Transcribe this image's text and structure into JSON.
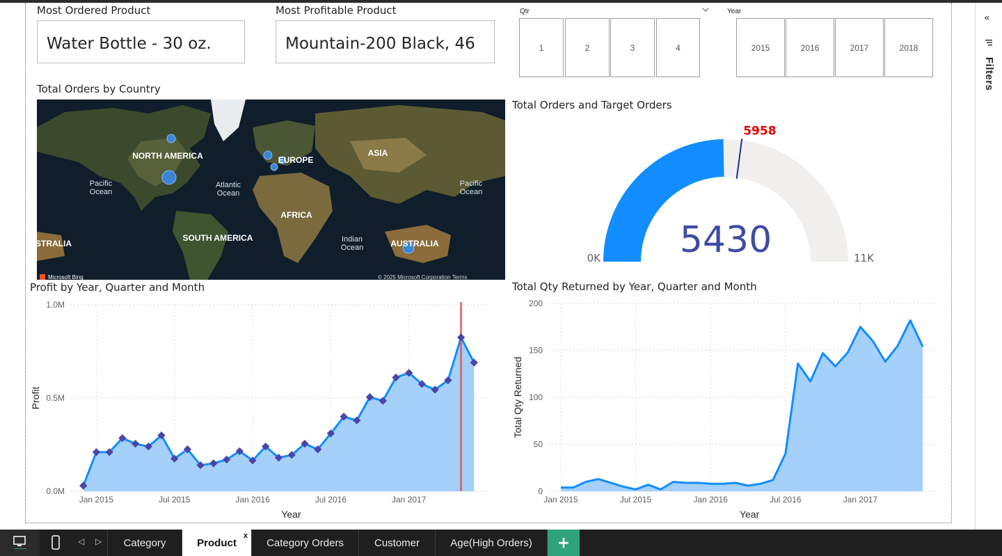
{
  "sidebar": {
    "collapse_glyph": "«",
    "filters_label": "Filters",
    "filter_icon": "filter-icon"
  },
  "cards": {
    "most_ordered": {
      "title": "Most Ordered Product",
      "value": "Water Bottle - 30 oz."
    },
    "most_profitable": {
      "title": "Most Profitable Product",
      "value": "Mountain-200 Black, 46"
    }
  },
  "slicers": {
    "qtr": {
      "title": "Qtr",
      "options": [
        "1",
        "2",
        "3",
        "4"
      ]
    },
    "year": {
      "title": "Year",
      "options": [
        "2015",
        "2016",
        "2017",
        "2018"
      ]
    }
  },
  "map": {
    "title": "Total Orders by Country",
    "labels": [
      "NORTH AMERICA",
      "EUROPE",
      "ASIA",
      "Pacific\nOcean",
      "Atlantic\nOcean",
      "Pacific\nOcean",
      "AFRICA",
      "SOUTH AMERICA",
      "Indian\nOcean",
      "AUSTRALIA",
      "STRALIA"
    ],
    "attribution_left": "Microsoft Bing",
    "attribution_right": "© 2025 Microsoft Corporation   Terms"
  },
  "gauge": {
    "title": "Total Orders and Target Orders",
    "value": 5430,
    "value_label": "5430",
    "target": 5958,
    "target_label": "5958",
    "min": 0,
    "max": 11000,
    "min_label": "0K",
    "max_label": "11K",
    "fill_color": "#118dff",
    "track_color": "#f0efee",
    "target_color": "#e80000",
    "value_color": "#3f4ba3"
  },
  "chart_data": [
    {
      "type": "area",
      "title": "Profit by Year, Quarter and Month",
      "xlabel": "Year",
      "ylabel": "Profit",
      "x_tick_labels": [
        "Jan 2015",
        "Jul 2015",
        "Jan 2016",
        "Jul 2016",
        "Jan 2017"
      ],
      "y_tick_labels": [
        "0.0M",
        "0.5M",
        "1.0M"
      ],
      "ylim": [
        0,
        1000000
      ],
      "x": [
        "2014-12",
        "2015-01",
        "2015-02",
        "2015-03",
        "2015-04",
        "2015-05",
        "2015-06",
        "2015-07",
        "2015-08",
        "2015-09",
        "2015-10",
        "2015-11",
        "2015-12",
        "2016-01",
        "2016-02",
        "2016-03",
        "2016-04",
        "2016-05",
        "2016-06",
        "2016-07",
        "2016-08",
        "2016-09",
        "2016-10",
        "2016-11",
        "2016-12",
        "2017-01",
        "2017-02",
        "2017-03",
        "2017-04",
        "2017-05",
        "2017-06"
      ],
      "values": [
        30000,
        210000,
        210000,
        285000,
        255000,
        240000,
        300000,
        175000,
        225000,
        140000,
        150000,
        170000,
        215000,
        165000,
        240000,
        180000,
        195000,
        255000,
        225000,
        310000,
        400000,
        380000,
        505000,
        485000,
        610000,
        635000,
        575000,
        545000,
        595000,
        825000,
        690000
      ],
      "highlight_x": "2017-05",
      "line_color": "#118dff",
      "fill_color": "#a4d0fa",
      "marker_color": "#4a46a8",
      "highlight_color": "#e05a5a",
      "grid": true
    },
    {
      "type": "area",
      "title": "Total Qty Returned by Year, Quarter and Month",
      "xlabel": "Year",
      "ylabel": "Total Qty Returned",
      "x_tick_labels": [
        "Jan 2015",
        "Jul 2015",
        "Jan 2016",
        "Jul 2016",
        "Jan 2017"
      ],
      "y_tick_labels": [
        "0",
        "50",
        "100",
        "150",
        "200"
      ],
      "ylim": [
        0,
        200
      ],
      "x": [
        "2015-01",
        "2015-02",
        "2015-03",
        "2015-04",
        "2015-05",
        "2015-06",
        "2015-07",
        "2015-08",
        "2015-09",
        "2015-10",
        "2015-11",
        "2015-12",
        "2016-01",
        "2016-02",
        "2016-03",
        "2016-04",
        "2016-05",
        "2016-06",
        "2016-07",
        "2016-08",
        "2016-09",
        "2016-10",
        "2016-11",
        "2016-12",
        "2017-01",
        "2017-02",
        "2017-03",
        "2017-04",
        "2017-05",
        "2017-06"
      ],
      "values": [
        4,
        4,
        10,
        13,
        9,
        5,
        2,
        7,
        2,
        10,
        9,
        9,
        8,
        8,
        9,
        6,
        8,
        12,
        40,
        136,
        117,
        147,
        133,
        148,
        175,
        160,
        138,
        155,
        182,
        154
      ],
      "line_color": "#118dff",
      "fill_color": "#a4d0fa",
      "grid": true
    }
  ],
  "bottom_tabs": {
    "icons": [
      "desktop-icon",
      "phone-icon",
      "prev-arrow-icon",
      "next-arrow-icon"
    ],
    "prev_glyph": "◁",
    "next_glyph": "▷",
    "pages": [
      "Category",
      "Product",
      "Category Orders",
      "Customer",
      "Age(High Orders)"
    ],
    "active_page": "Product",
    "close_glyph": "x",
    "add_glyph": "+"
  }
}
